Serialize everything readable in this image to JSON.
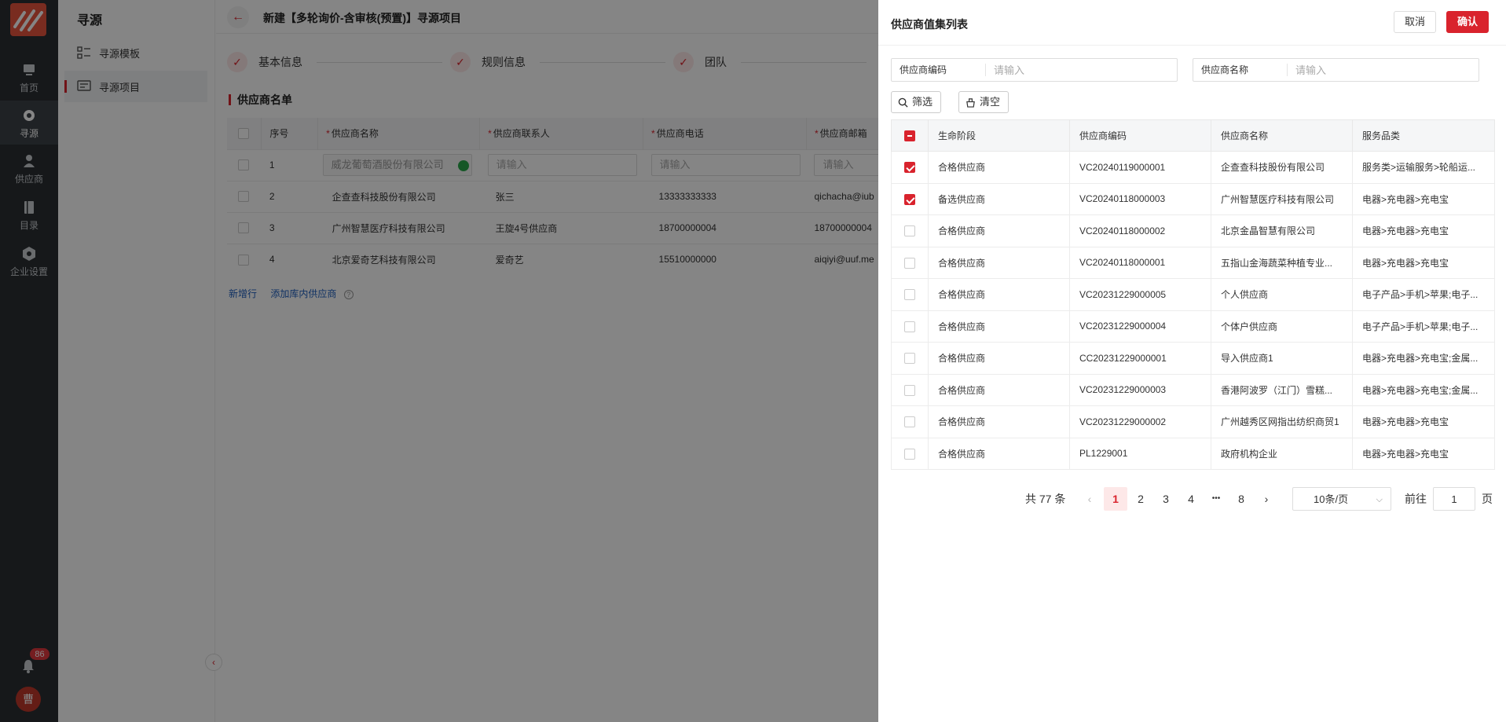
{
  "rail": {
    "items": [
      {
        "label": "首页",
        "icon": "home-icon"
      },
      {
        "label": "寻源",
        "icon": "sourcing-icon"
      },
      {
        "label": "供应商",
        "icon": "supplier-icon"
      },
      {
        "label": "目录",
        "icon": "catalog-icon"
      },
      {
        "label": "企业设置",
        "icon": "settings-icon"
      }
    ],
    "notifications": "86",
    "avatar_text": "曹"
  },
  "sidebar": {
    "title": "寻源",
    "items": [
      {
        "label": "寻源模板",
        "icon": "template-icon"
      },
      {
        "label": "寻源项目",
        "icon": "project-icon"
      }
    ]
  },
  "main": {
    "back": "←",
    "title": "新建【多轮询价-含审核(预置)】寻源项目",
    "steps": [
      {
        "label": "基本信息"
      },
      {
        "label": "规则信息"
      },
      {
        "label": "团队"
      }
    ],
    "section_title": "供应商名单",
    "columns": [
      "序号",
      "供应商名称",
      "供应商联系人",
      "供应商电话",
      "供应商邮箱"
    ],
    "rows": [
      {
        "no": "1",
        "name": "威龙葡萄酒股份有限公司",
        "contact": "请输入",
        "phone": "请输入",
        "email": "请输入"
      },
      {
        "no": "2",
        "name": "企查查科技股份有限公司",
        "contact": "张三",
        "phone": "13333333333",
        "email": "qichacha@iub"
      },
      {
        "no": "3",
        "name": "广州智慧医疗科技有限公司",
        "contact": "王旋4号供应商",
        "phone": "18700000004",
        "email": "18700000004"
      },
      {
        "no": "4",
        "name": "北京爱奇艺科技有限公司",
        "contact": "爱奇艺",
        "phone": "15510000000",
        "email": "aiqiyi@uuf.me"
      }
    ],
    "add_row": "新增行",
    "add_from_library": "添加库内供应商",
    "help": "?"
  },
  "drawer": {
    "title": "供应商值集列表",
    "cancel": "取消",
    "confirm": "确认",
    "filters": [
      {
        "label": "供应商编码",
        "placeholder": "请输入"
      },
      {
        "label": "供应商名称",
        "placeholder": "请输入"
      }
    ],
    "filter_btn": "筛选",
    "clear_btn": "清空",
    "columns": [
      "生命阶段",
      "供应商编码",
      "供应商名称",
      "服务品类"
    ],
    "rows": [
      {
        "checked": true,
        "stage": "合格供应商",
        "code": "VC20240119000001",
        "name": "企查查科技股份有限公司",
        "category": "服务类>运输服务>轮船运..."
      },
      {
        "checked": true,
        "stage": "备选供应商",
        "code": "VC20240118000003",
        "name": "广州智慧医疗科技有限公司",
        "category": "电器>充电器>充电宝"
      },
      {
        "checked": false,
        "stage": "合格供应商",
        "code": "VC20240118000002",
        "name": "北京金晶智慧有限公司",
        "category": "电器>充电器>充电宝"
      },
      {
        "checked": false,
        "stage": "合格供应商",
        "code": "VC20240118000001",
        "name": "五指山金海蔬菜种植专业...",
        "category": "电器>充电器>充电宝"
      },
      {
        "checked": false,
        "stage": "合格供应商",
        "code": "VC20231229000005",
        "name": "个人供应商",
        "category": "电子产品>手机>苹果;电子..."
      },
      {
        "checked": false,
        "stage": "合格供应商",
        "code": "VC20231229000004",
        "name": "个体户供应商",
        "category": "电子产品>手机>苹果;电子..."
      },
      {
        "checked": false,
        "stage": "合格供应商",
        "code": "CC20231229000001",
        "name": "导入供应商1",
        "category": "电器>充电器>充电宝;金属..."
      },
      {
        "checked": false,
        "stage": "合格供应商",
        "code": "VC20231229000003",
        "name": "香港阿波罗（江门）雪糕...",
        "category": "电器>充电器>充电宝;金属..."
      },
      {
        "checked": false,
        "stage": "合格供应商",
        "code": "VC20231229000002",
        "name": "广州越秀区网指出纺织商贸1",
        "category": "电器>充电器>充电宝"
      },
      {
        "checked": false,
        "stage": "合格供应商",
        "code": "PL1229001",
        "name": "政府机构企业",
        "category": "电器>充电器>充电宝"
      }
    ],
    "pager": {
      "total": "共 77 条",
      "prev": "‹",
      "pages": [
        "1",
        "2",
        "3",
        "4",
        "•••",
        "8"
      ],
      "current": "1",
      "next": "›",
      "page_size": "10条/页",
      "goto_label": "前往",
      "goto_value": "1",
      "goto_suffix": "页"
    }
  },
  "colors": {
    "accent": "#d9232d",
    "rail": "#2b2f33"
  }
}
